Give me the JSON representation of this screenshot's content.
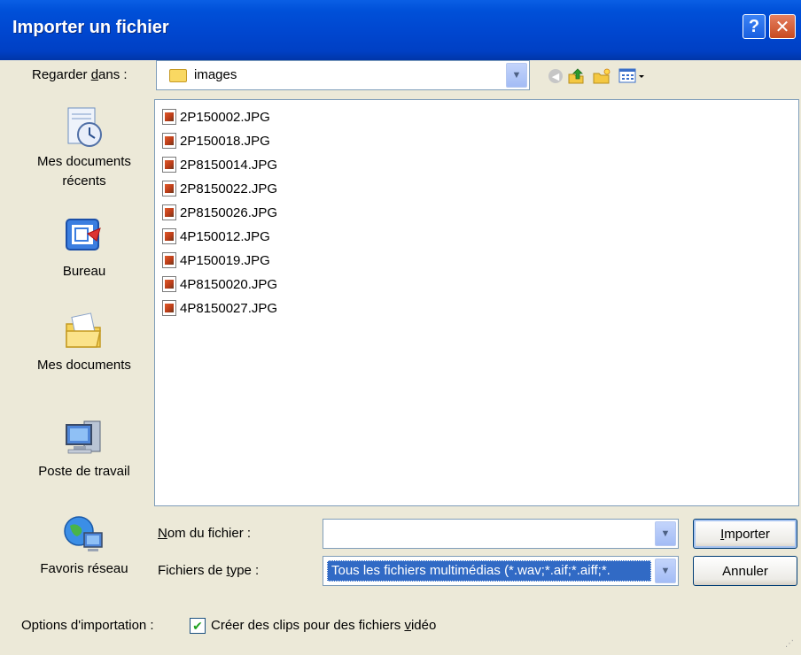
{
  "window": {
    "title": "Importer un fichier",
    "help_symbol": "?",
    "close_symbol": "✕"
  },
  "toolbar": {
    "lookin_label_pre": "Regarder ",
    "lookin_label_u": "d",
    "lookin_label_post": "ans :",
    "lookin_value": "images",
    "icons": [
      "back-icon",
      "up-folder-icon",
      "new-folder-icon",
      "views-menu-icon"
    ]
  },
  "places": [
    {
      "label": "Mes documents récents",
      "icon": "recent-documents-icon"
    },
    {
      "label": "Bureau",
      "icon": "desktop-icon"
    },
    {
      "label": "Mes documents",
      "icon": "my-documents-icon"
    },
    {
      "label": "Poste de travail",
      "icon": "my-computer-icon"
    },
    {
      "label": "Favoris réseau",
      "icon": "network-places-icon"
    }
  ],
  "files": [
    "2P150002.JPG",
    "2P150018.JPG",
    "2P8150014.JPG",
    "2P8150022.JPG",
    "2P8150026.JPG",
    "4P150012.JPG",
    "4P150019.JPG",
    "4P8150020.JPG",
    "4P8150027.JPG"
  ],
  "form": {
    "filename_label_u": "N",
    "filename_label_post": "om du fichier :",
    "filename_value": "",
    "filetype_label_pre": "Fichiers de ",
    "filetype_label_u": "t",
    "filetype_label_post": "ype :",
    "filetype_value": "Tous les fichiers multimédias (*.wav;*.aif;*.aiff;*."
  },
  "buttons": {
    "import_u": "I",
    "import_post": "mporter",
    "cancel": "Annuler"
  },
  "options": {
    "label": "Options d'importation :",
    "checkbox_checked": true,
    "checkbox_label_pre": "Créer des clips pour des fichiers ",
    "checkbox_label_u": "v",
    "checkbox_label_post": "idéo"
  },
  "colors": {
    "titlebar": "#0046cf",
    "selection": "#316ac5",
    "dialog_bg": "#ece9d8"
  }
}
